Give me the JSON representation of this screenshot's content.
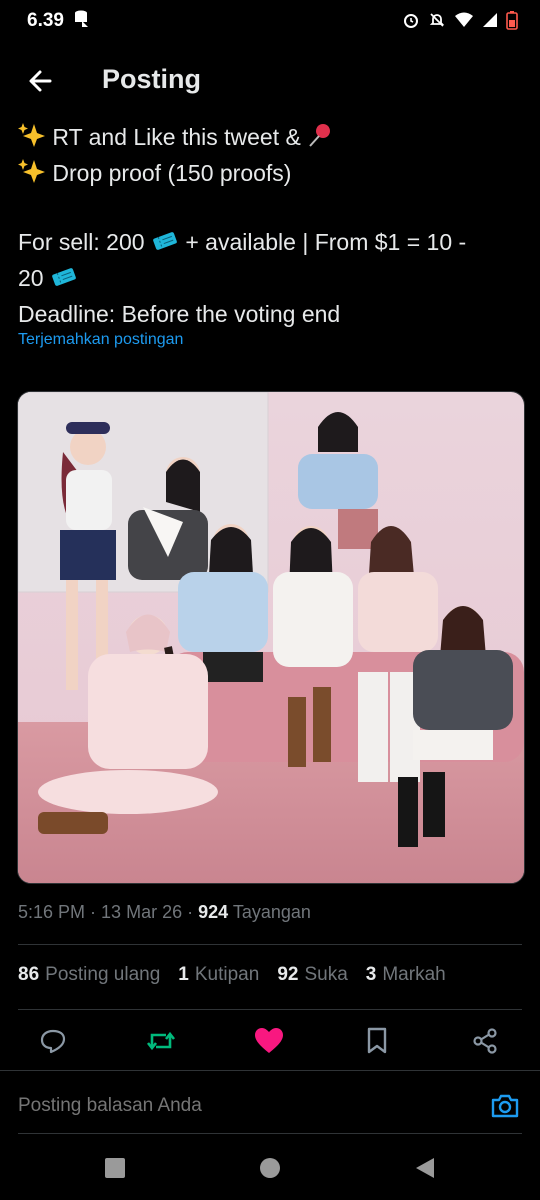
{
  "status_bar": {
    "time": "6.39"
  },
  "header": {
    "title": "Posting"
  },
  "tweet": {
    "line1": "RT and Like this tweet &",
    "line2": "Drop proof (150 proofs)",
    "line3a": "For sell: 200",
    "line3b": "+ available | From $1 = 10 -",
    "line3c": "20",
    "line4": "Deadline: Before the voting end",
    "translate": "Terjemahkan postingan"
  },
  "meta": {
    "time": "5:16 PM",
    "date": "13 Mar 26",
    "views": "924",
    "views_label": "Tayangan"
  },
  "stats": {
    "reposts": "86",
    "reposts_label": "Posting ulang",
    "quotes": "1",
    "quotes_label": "Kutipan",
    "likes": "92",
    "likes_label": "Suka",
    "bookmarks": "3",
    "bookmarks_label": "Markah"
  },
  "reply": {
    "placeholder": "Posting balasan Anda"
  },
  "colors": {
    "accent": "#1d9bf0",
    "like": "#f91880",
    "repost": "#00ba7c",
    "muted": "#71767b"
  },
  "icons": [
    "back-arrow-icon",
    "sparkles-icon",
    "pushpin-icon",
    "ticket-icon",
    "reply-icon",
    "repost-icon",
    "like-icon",
    "bookmark-icon",
    "share-icon",
    "camera-icon"
  ]
}
